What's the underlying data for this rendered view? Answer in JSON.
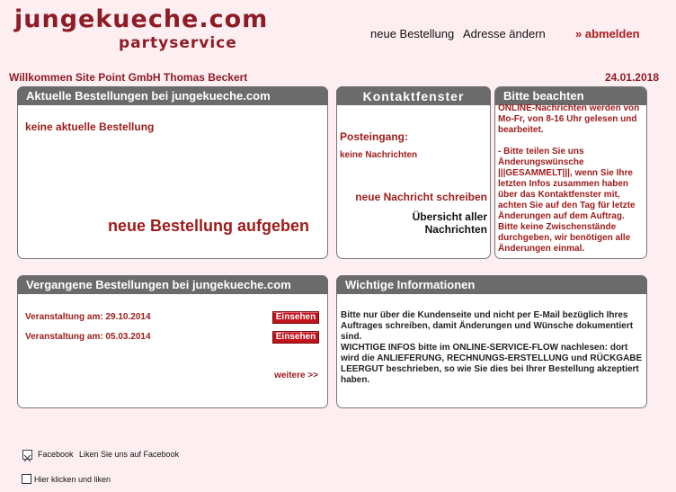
{
  "header": {
    "logo_main": "jungekueche.com",
    "logo_sub": "partyservice",
    "nav_new_order": "neue Bestellung",
    "nav_change_address": "Adresse ändern",
    "nav_logout": "» abmelden"
  },
  "welcome": "Willkommen Site Point GmbH Thomas Beckert",
  "date": "24.01.2018",
  "current_orders": {
    "title": "Aktuelle Bestellungen bei jungekueche.com",
    "empty": "keine aktuelle Bestellung",
    "cta": "neue Bestellung aufgeben"
  },
  "contact": {
    "title": "Kontaktfenster",
    "inbox_label": "Posteingang:",
    "inbox_empty": "keine Nachrichten",
    "write": "neue Nachricht schreiben",
    "overview_line1": "Übersicht aller",
    "overview_line2": "Nachrichten"
  },
  "notice": {
    "title": "Bitte beachten",
    "text": "ONLINE-Nachrichten werden von Mo-Fr, von 8-16 Uhr gelesen und bearbeitet.",
    "text2": "- Bitte teilen Sie uns Änderungswünsche |||GESAMMELT|||, wenn Sie Ihre letzten Infos zusammen haben über das Kontaktfenster mit, achten Sie auf den Tag für letzte Änderungen auf dem Auftrag. Bitte keine Zwischenstände durchgeben, wir benötigen alle Änderungen einmal."
  },
  "past_orders": {
    "title": "Vergangene Bestellungen bei jungekueche.com",
    "rows": [
      {
        "label": "Veranstaltung am: 29.10.2014",
        "button": "Einsehen"
      },
      {
        "label": "Veranstaltung am: 05.03.2014",
        "button": "Einsehen"
      }
    ],
    "more": "weitere >>"
  },
  "important": {
    "title": "Wichtige Informationen",
    "text": "Bitte nur über die Kundenseite und nicht per E-Mail bezüglich Ihres Auftrages schreiben, damit Änderungen und Wünsche dokumentiert sind.",
    "text2": "WICHTIGE INFOS bitte im ONLINE-SERVICE-FLOW nachlesen: dort wird die ANLIEFERUNG, RECHNUNGS-ERSTELLUNG und RÜCKGABE LEERGUT beschrieben, so wie Sie dies bei Ihrer Bestellung akzeptiert haben."
  },
  "facebook": {
    "label": "Facebook",
    "like_text": "Liken Sie uns auf Facebook",
    "checkbox_label": "Hier klicken und liken",
    "icon": "broken-image-icon"
  }
}
